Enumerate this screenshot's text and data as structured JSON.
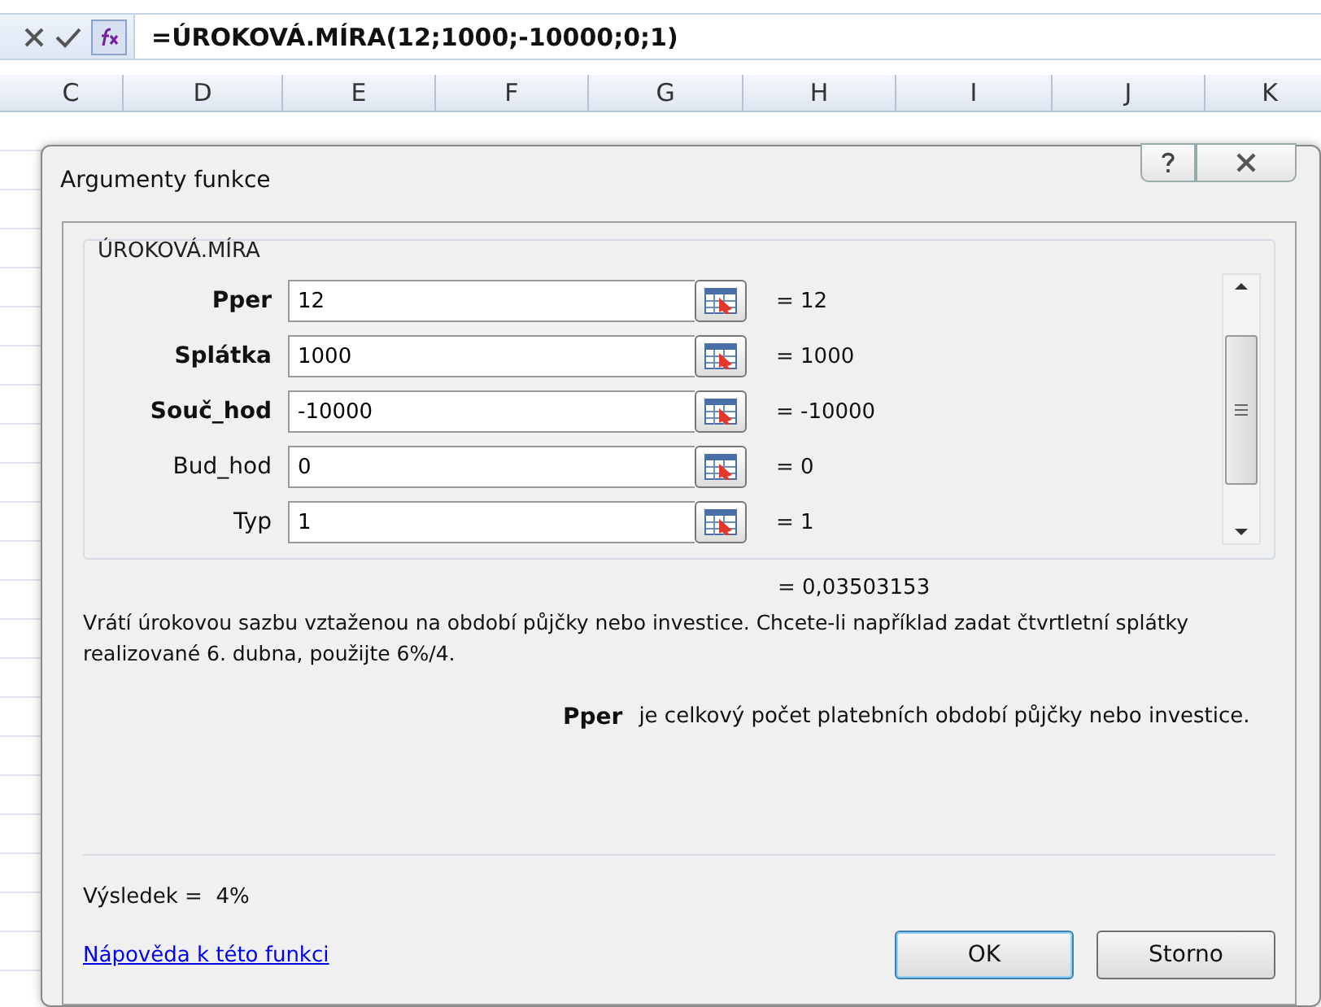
{
  "formula_bar": {
    "formula": "=ÚROKOVÁ.MÍRA(12;1000;-10000;0;1)"
  },
  "columns": [
    "C",
    "D",
    "E",
    "F",
    "G",
    "H",
    "I",
    "J",
    "K"
  ],
  "dialog": {
    "title": "Argumenty funkce",
    "function_name": "ÚROKOVÁ.MÍRA",
    "arguments": [
      {
        "label": "Pper",
        "required": true,
        "value": "12",
        "result": "= 12"
      },
      {
        "label": "Splátka",
        "required": true,
        "value": "1000",
        "result": "= 1000"
      },
      {
        "label": "Souč_hod",
        "required": true,
        "value": "-10000",
        "result": "= -10000"
      },
      {
        "label": "Bud_hod",
        "required": false,
        "value": "0",
        "result": "= 0"
      },
      {
        "label": "Typ",
        "required": false,
        "value": "1",
        "result": "= 1"
      }
    ],
    "formula_result": "= 0,03503153",
    "description": "Vrátí úrokovou sazbu vztaženou na období půjčky nebo investice. Chcete-li například zadat čtvrtletní splátky realizované 6. dubna, použijte 6%/4.",
    "argument_name": "Pper",
    "argument_help": "je celkový počet platebních období půjčky nebo investice.",
    "result_label": "Výsledek =",
    "result_value": "4%",
    "help_link": "Nápověda k této funkci",
    "buttons": [
      {
        "label": "OK",
        "selected": true
      },
      {
        "label": "Storno",
        "selected": false
      }
    ]
  }
}
